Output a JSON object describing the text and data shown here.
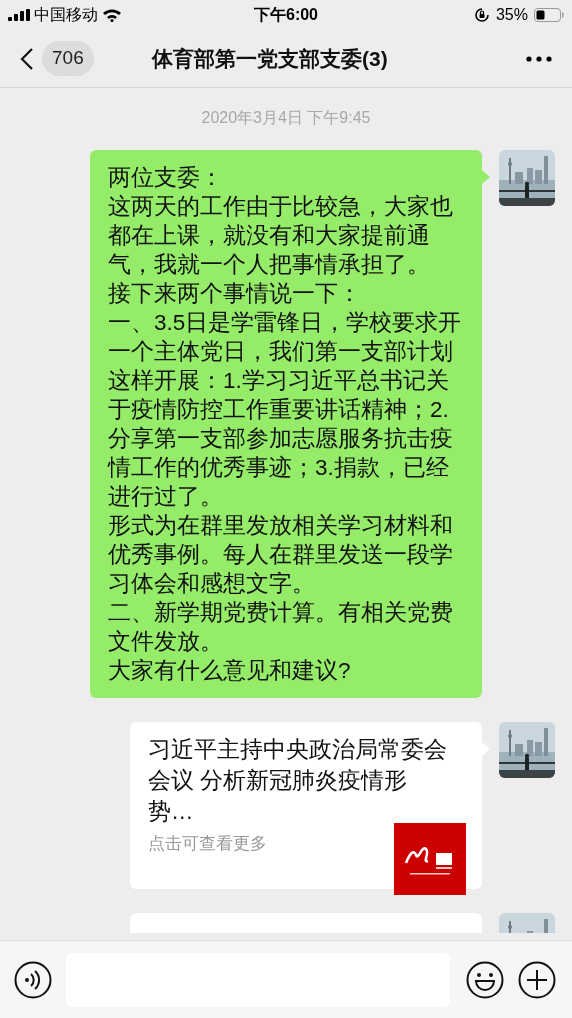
{
  "status_bar": {
    "carrier": "中国移动",
    "time": "下午6:00",
    "battery": "35%"
  },
  "nav": {
    "back_count": "706",
    "title": "体育部第一党支部支委(3)"
  },
  "timestamp": "2020年3月4日 下午9:45",
  "messages": [
    {
      "kind": "text",
      "paragraphs": [
        "两位支委：",
        "这两天的工作由于比较急，大家也都在上课，就没有和大家提前通气，我就一个人把事情承担了。",
        "接下来两个事情说一下：",
        "一、3.5日是学雷锋日，学校要求开一个主体党日，我们第一支部计划这样开展：1.学习习近平总书记关于疫情防控工作重要讲话精神；2.分享第一支部参加志愿服务抗击疫情工作的优秀事迹；3.捐款，已经进行过了。",
        "形式为在群里发放相关学习材料和优秀事例。每人在群里发送一段学习体会和感想文字。",
        "二、新学期党费计算。有相关党费文件发放。",
        "大家有什么意见和建议?"
      ]
    },
    {
      "kind": "link",
      "title": "习近平主持中央政治局常委会会议 分析新冠肺炎疫情形势…",
      "subtitle": "点击可查看更多"
    },
    {
      "kind": "link_partial"
    }
  ]
}
